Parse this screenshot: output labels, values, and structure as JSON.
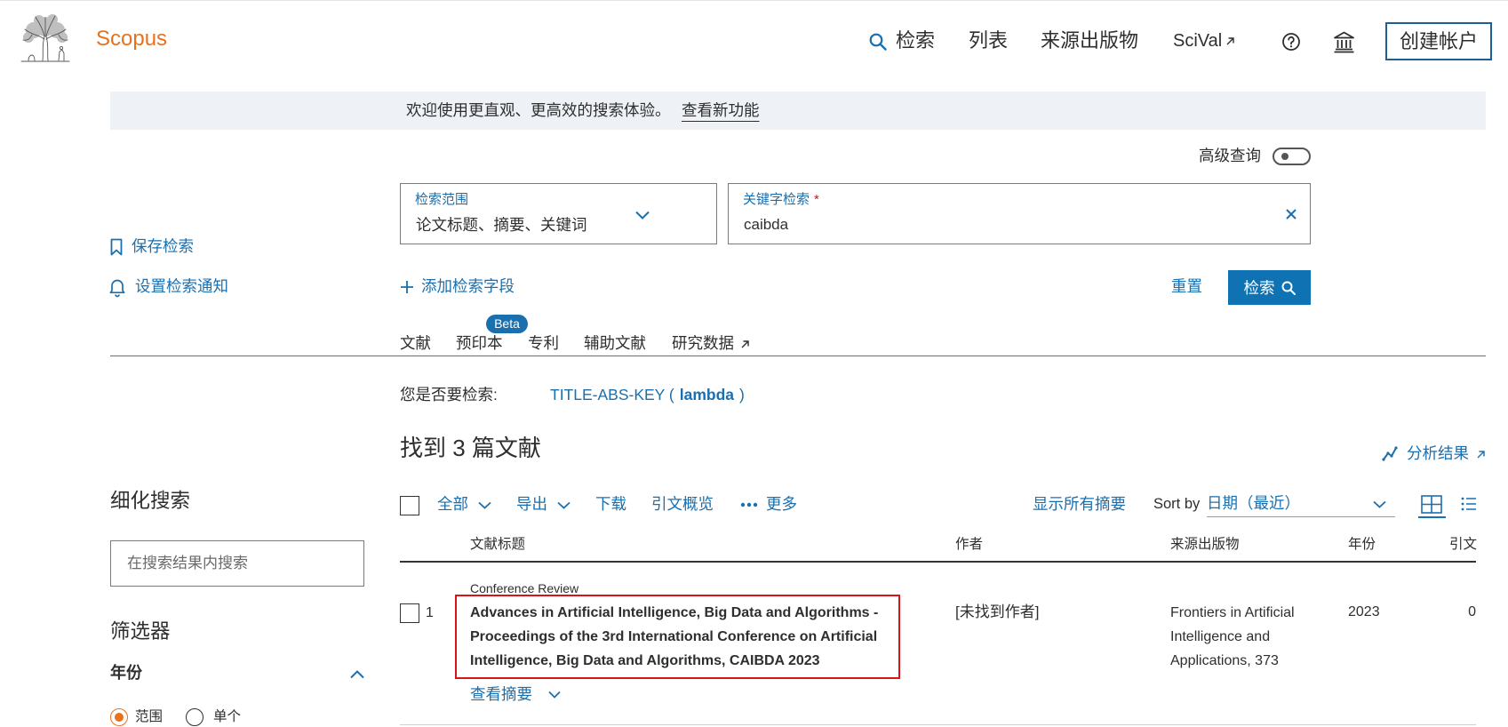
{
  "colors": {
    "brand": "#e9711c",
    "link": "#1a6fae",
    "button": "#0f73b3",
    "text": "#2e2e2e",
    "banner": "#eef2f6",
    "highlight": "#d7141a",
    "radio": "#e9711c"
  },
  "icons": {
    "logo": "elsevier-tree-logo",
    "search": "search-icon",
    "external": "external-link-icon",
    "help": "help-icon",
    "institution": "institution-icon",
    "bookmark": "bookmark-icon",
    "alert": "bell-icon",
    "add": "plus-icon",
    "clear": "close-icon",
    "analyze": "line-chart-icon",
    "more": "more-dots-icon",
    "grid_view": "grid-view-icon",
    "list_view": "list-view-icon"
  },
  "header": {
    "brand": "Scopus",
    "nav": {
      "search": "检索",
      "lists": "列表",
      "sources": "来源出版物",
      "scival": "SciVal"
    },
    "create_account": "创建帐户"
  },
  "banner": {
    "text": "欢迎使用更直观、更高效的搜索体验。",
    "link": "查看新功能"
  },
  "search": {
    "advanced_label": "高级查询",
    "advanced_enabled": false,
    "scope": {
      "label": "检索范围",
      "value": "论文标题、摘要、关键词"
    },
    "keyword": {
      "label": "关键字检索",
      "required_mark": "*",
      "value": "caibda"
    },
    "add_field": "添加检索字段",
    "reset": "重置",
    "submit": "检索"
  },
  "sidebar_actions": {
    "save_search": "保存检索",
    "set_alert": "设置检索通知"
  },
  "tabs": [
    {
      "label": "文献"
    },
    {
      "label": "预印本",
      "badge": "Beta"
    },
    {
      "label": "专利"
    },
    {
      "label": "辅助文献"
    },
    {
      "label": "研究数据"
    }
  ],
  "did_you_mean": {
    "label": "您是否要检索:",
    "query_prefix": "TITLE-ABS-KEY (",
    "query_term": "lambda",
    "query_suffix": ")"
  },
  "results": {
    "count_text": "找到 3 篇文献",
    "analyze": "分析结果"
  },
  "refine": {
    "title": "细化搜索",
    "search_placeholder": "在搜索结果内搜索",
    "filters_title": "筛选器",
    "year": {
      "label": "年份",
      "options": [
        {
          "label": "范围",
          "selected": true
        },
        {
          "label": "单个",
          "selected": false
        }
      ]
    }
  },
  "toolbar": {
    "select_all": "全部",
    "export": "导出",
    "download": "下载",
    "citation_overview": "引文概览",
    "more": "更多",
    "show_abstracts": "显示所有摘要",
    "sort_label": "Sort by",
    "sort_value": "日期（最近）"
  },
  "table": {
    "headers": {
      "title": "文献标题",
      "authors": "作者",
      "source": "来源出版物",
      "year": "年份",
      "citations": "引文"
    },
    "rows": [
      {
        "index": "1",
        "doc_type": "Conference Review",
        "title_lines": [
          "Advances in Artificial Intelligence, Big Data and Algorithms -",
          "Proceedings of the 3rd International Conference on Artificial",
          "Intelligence, Big Data and Algorithms, CAIBDA 2023"
        ],
        "authors": "[未找到作者]",
        "source_lines": [
          "Frontiers in Artificial",
          "Intelligence and",
          "Applications, 373"
        ],
        "year": "2023",
        "citations": "0",
        "view_abstract": "查看摘要"
      }
    ]
  }
}
